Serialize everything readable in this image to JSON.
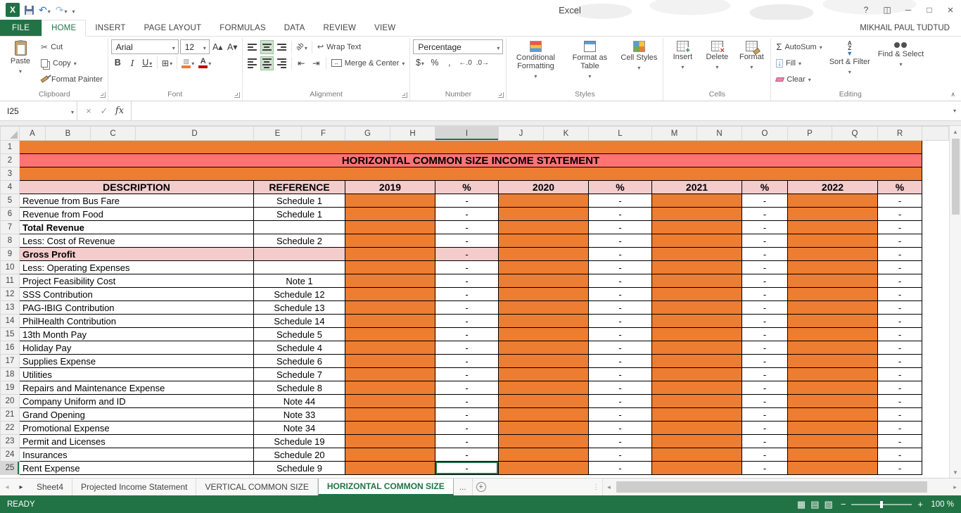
{
  "colors": {
    "excel_green": "#217346",
    "orange_fill": "#ED7D31",
    "banner_red": "#FF7373",
    "header_pink": "#F4CCCC",
    "fill_swatch": "#ED7D31",
    "font_color_swatch": "#C00000"
  },
  "titlebar": {
    "app_title": "Excel",
    "user_name": "MIKHAIL PAUL TUDTUD"
  },
  "glyphs": {
    "help": "?",
    "ribbon_options": "◫",
    "minimize": "─",
    "maximize": "□",
    "close": "×",
    "undo": "↶",
    "redo": "↷",
    "cut": "✂",
    "borders": "⊞",
    "accounting": "$",
    "percent": "%",
    "comma": ",",
    "increase_decimal": "←.0",
    "decrease_decimal": ".0→",
    "autosum_sigma": "Σ",
    "fill_arrow": "↓",
    "grow_font": "A▴",
    "shrink_font": "A▾",
    "bold": "B",
    "italic": "I",
    "underline": "U",
    "orientation": "ab",
    "cancel": "×",
    "enter": "✓",
    "fx": "fx",
    "wrap_return": "↩",
    "merge_arrows": "↔",
    "outdent": "⇤",
    "indent": "⇥",
    "sort_a": "A",
    "sort_z": "Z",
    "funnel": "▼",
    "new_sheet_plus": "+",
    "nav_prev": "◂",
    "nav_next": "▸",
    "scroll_up": "▲",
    "scroll_down": "▼",
    "scroll_left": "◂",
    "scroll_right": "▸",
    "view_normal": "▦",
    "view_page_layout": "▤",
    "view_page_break": "▧",
    "zoom_out": "−",
    "zoom_in": "+",
    "dots": "⋮",
    "collapse_ribbon": "∧"
  },
  "ribbon_tabs": [
    {
      "label": "FILE",
      "file": true
    },
    {
      "label": "HOME",
      "active": true
    },
    {
      "label": "INSERT"
    },
    {
      "label": "PAGE LAYOUT"
    },
    {
      "label": "FORMULAS"
    },
    {
      "label": "DATA"
    },
    {
      "label": "REVIEW"
    },
    {
      "label": "VIEW"
    }
  ],
  "ribbon": {
    "clipboard": {
      "label": "Clipboard",
      "paste": "Paste",
      "cut": "Cut",
      "copy": "Copy",
      "format_painter": "Format Painter"
    },
    "font": {
      "label": "Font",
      "font_name": "Arial",
      "font_size": "12"
    },
    "alignment": {
      "label": "Alignment",
      "wrap_text": "Wrap Text",
      "merge_center": "Merge & Center"
    },
    "number": {
      "label": "Number",
      "format": "Percentage"
    },
    "styles": {
      "label": "Styles",
      "conditional": "Conditional Formatting",
      "format_table": "Format as Table",
      "cell_styles": "Cell Styles"
    },
    "cells": {
      "label": "Cells",
      "insert": "Insert",
      "delete": "Delete",
      "format": "Format"
    },
    "editing": {
      "label": "Editing",
      "autosum": "AutoSum",
      "fill": "Fill",
      "clear": "Clear",
      "sort_filter": "Sort & Filter",
      "find_select": "Find & Select"
    }
  },
  "formula_bar": {
    "name_box": "I25",
    "formula": ""
  },
  "grid": {
    "columns": [
      "A",
      "B",
      "C",
      "D",
      "E",
      "F",
      "G",
      "H",
      "I",
      "J",
      "K",
      "L",
      "M",
      "N",
      "O",
      "P",
      "Q",
      "R"
    ],
    "selected_column": "I",
    "selected_row": 25,
    "active_cell": "I25",
    "banner_title": "HORIZONTAL COMMON SIZE INCOME STATEMENT",
    "headers": {
      "description": "DESCRIPTION",
      "reference": "REFERENCE",
      "percent": "%",
      "years": [
        "2019",
        "2020",
        "2021",
        "2022"
      ]
    },
    "dash": "-",
    "rows": [
      {
        "n": 5,
        "description": "Revenue from Bus Fare",
        "reference": "Schedule 1"
      },
      {
        "n": 6,
        "description": "Revenue from Food",
        "reference": "Schedule 1"
      },
      {
        "n": 7,
        "description": "Total Revenue",
        "reference": "",
        "bold": true
      },
      {
        "n": 8,
        "description": "Less: Cost of Revenue",
        "reference": "Schedule 2"
      },
      {
        "n": 9,
        "description": "Gross Profit",
        "reference": "",
        "bold": true,
        "pink": true
      },
      {
        "n": 10,
        "description": "Less: Operating Expenses",
        "reference": ""
      },
      {
        "n": 11,
        "description": "Project Feasibility Cost",
        "reference": "Note 1"
      },
      {
        "n": 12,
        "description": "SSS Contribution",
        "reference": "Schedule 12"
      },
      {
        "n": 13,
        "description": "PAG-IBIG Contribution",
        "reference": "Schedule 13"
      },
      {
        "n": 14,
        "description": "PhilHealth Contribution",
        "reference": "Schedule 14"
      },
      {
        "n": 15,
        "description": "13th Month Pay",
        "reference": "Schedule 5"
      },
      {
        "n": 16,
        "description": "Holiday Pay",
        "reference": "Schedule 4"
      },
      {
        "n": 17,
        "description": "Supplies Expense",
        "reference": "Schedule 6"
      },
      {
        "n": 18,
        "description": "Utilities",
        "reference": "Schedule 7"
      },
      {
        "n": 19,
        "description": "Repairs and Maintenance Expense",
        "reference": "Schedule 8"
      },
      {
        "n": 20,
        "description": "Company Uniform and ID",
        "reference": "Note 44"
      },
      {
        "n": 21,
        "description": "Grand Opening",
        "reference": "Note 33"
      },
      {
        "n": 22,
        "description": "Promotional Expense",
        "reference": "Note 34"
      },
      {
        "n": 23,
        "description": "Permit and Licenses",
        "reference": "Schedule 19"
      },
      {
        "n": 24,
        "description": "Insurances",
        "reference": "Schedule 20"
      },
      {
        "n": 25,
        "description": "Rent Expense",
        "reference": "Schedule 9"
      }
    ]
  },
  "sheet_tabs": {
    "tabs": [
      {
        "label": "Sheet4"
      },
      {
        "label": "Projected Income Statement"
      },
      {
        "label": "VERTICAL COMMON SIZE"
      },
      {
        "label": "HORIZONTAL COMMON SIZE",
        "active": true
      }
    ],
    "overflow": "..."
  },
  "status_bar": {
    "mode": "READY",
    "zoom_level": "100 %"
  }
}
